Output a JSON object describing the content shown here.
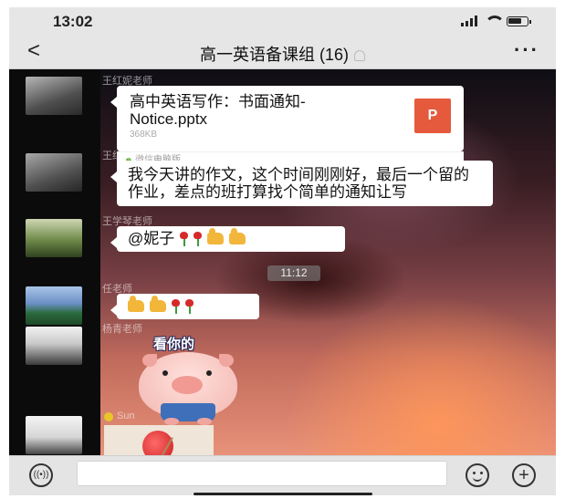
{
  "status_bar": {
    "time": "13:02"
  },
  "nav": {
    "back": "<",
    "title": "高一英语备课组 (16)",
    "more": "···"
  },
  "messages": [
    {
      "sender": "王红妮老师",
      "type": "file",
      "file_name": "高中英语写作：书面通知-Notice.pptx",
      "file_size": "368KB",
      "file_icon": "P",
      "source": "微信电脑版"
    },
    {
      "sender": "王红妮老师",
      "type": "text",
      "text": "我今天讲的作文，这个时间刚刚好，最后一个留的作业，差点的班打算找个简单的通知让写"
    },
    {
      "sender": "王学琴老师",
      "type": "text",
      "text": "@妮子"
    },
    {
      "sender": "任老师",
      "type": "emoji"
    },
    {
      "sender": "杨青老师",
      "type": "sticker",
      "sticker_text": "看你的"
    },
    {
      "sender": "Sun",
      "type": "image"
    }
  ],
  "timestamp": "11:12",
  "input_bar": {
    "plus": "+"
  },
  "icons": {
    "back": "chevron-left-icon",
    "mute": "bell-muted-icon",
    "voice": "voice-icon",
    "emoji": "smiley-icon",
    "plus": "plus-circle-icon"
  },
  "colors": {
    "bubble": "#ffffff",
    "pptx_icon": "#e55a3c",
    "bar": "#e6e6e6"
  }
}
